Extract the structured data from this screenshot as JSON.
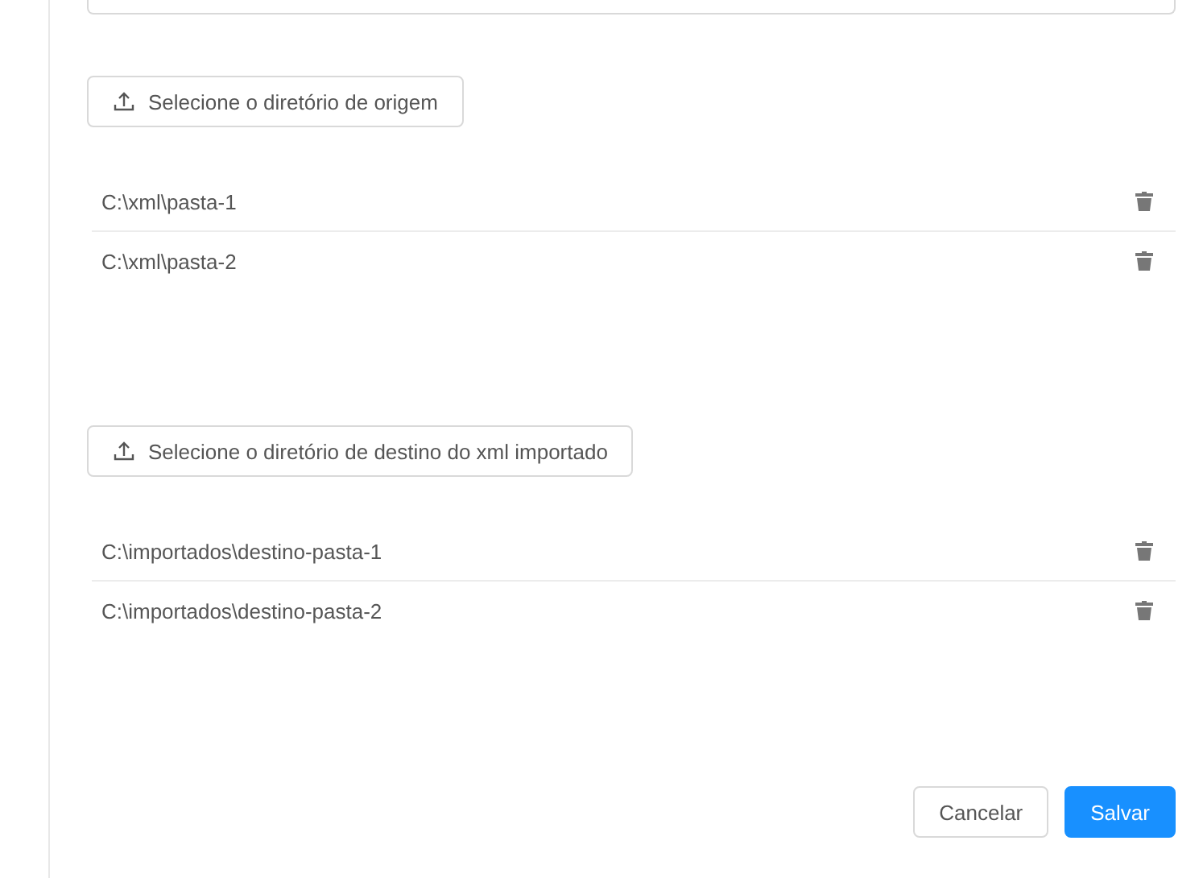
{
  "sections": [
    {
      "button": "Selecione o diretório de origem",
      "paths": [
        "C:\\xml\\pasta-1",
        "C:\\xml\\pasta-2"
      ]
    },
    {
      "button": "Selecione o diretório de destino do xml importado",
      "paths": [
        "C:\\importados\\destino-pasta-1",
        "C:\\importados\\destino-pasta-2"
      ]
    }
  ],
  "footer": {
    "cancel": "Cancelar",
    "save": "Salvar"
  }
}
